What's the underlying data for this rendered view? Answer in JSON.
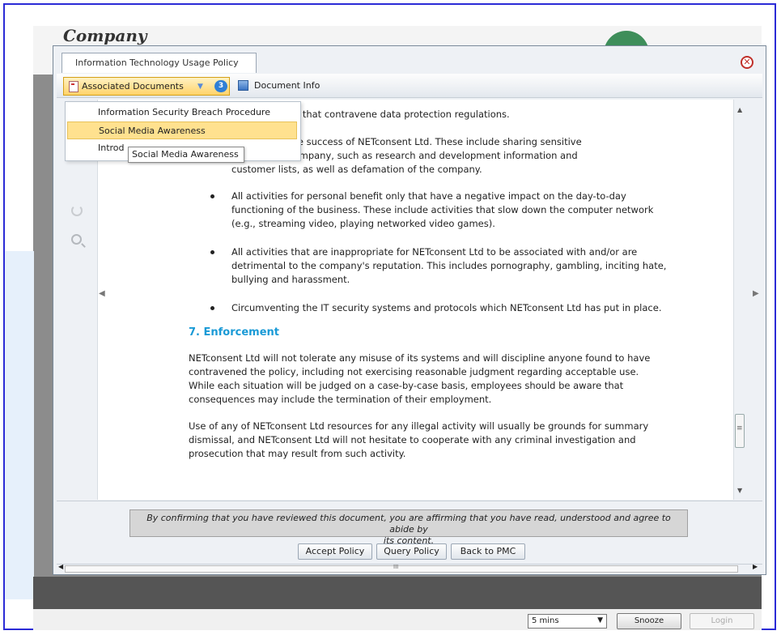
{
  "background": {
    "logo_text": "Company",
    "snooze_value": "5 mins",
    "snooze_label": "Snooze",
    "login_label": "Login"
  },
  "dialog": {
    "tab_title": "Information Technology Usage Policy",
    "toolbar": {
      "associated_documents_label": "Associated Documents",
      "associated_documents_count": "3",
      "document_info_label": "Document Info"
    },
    "dropdown": {
      "items": [
        "Information Security Breach Procedure",
        "Social Media Awareness",
        "Introd"
      ],
      "selected_index": 1,
      "tooltip": "Social Media Awareness"
    },
    "document": {
      "partial_lines": [
        "ude activities that contravene data protection regulations.",
        "rimental to the success of NETconsent Ltd.  These include sharing sensitive",
        "tside the company, such as research and development information and",
        "customer lists, as well as defamation of the company."
      ],
      "bullets": [
        [
          "All activities for personal benefit only that have a negative impact on the day-to-day",
          "functioning of the business. These include activities that slow down the computer network",
          "(e.g., streaming video, playing networked video games)."
        ],
        [
          "All activities that are inappropriate for NETconsent Ltd to be associated with and/or are",
          "detrimental to the company's reputation. This includes pornography, gambling, inciting hate,",
          "bullying and harassment."
        ],
        [
          "Circumventing the IT security systems and protocols which NETconsent Ltd has put in place."
        ]
      ],
      "section_heading": "7. Enforcement",
      "paragraphs": [
        [
          "NETconsent Ltd will not tolerate any misuse of its systems and will discipline anyone found to have",
          "contravened the policy, including not exercising reasonable judgment regarding acceptable use.",
          "While each situation will be judged on a case-by-case basis, employees should be aware that",
          "consequences may include the termination of their employment."
        ],
        [
          "Use of any of NETconsent Ltd resources for any illegal activity will usually be grounds for summary",
          "dismissal, and NETconsent Ltd will not hesitate to cooperate with any criminal investigation and",
          "prosecution that may result from such activity."
        ]
      ]
    },
    "footer": {
      "confirmation_line1": "By confirming that you have reviewed this document, you are affirming that you have read, understood and agree to abide by",
      "confirmation_line2": "its content.",
      "accept_label": "Accept Policy",
      "query_label": "Query Policy",
      "back_label": "Back to PMC"
    }
  },
  "colors": {
    "heading": "#1a9ad6",
    "highlight": "#ffe18f",
    "badge": "#2f7fd6",
    "frame": "#2b2bd6"
  }
}
